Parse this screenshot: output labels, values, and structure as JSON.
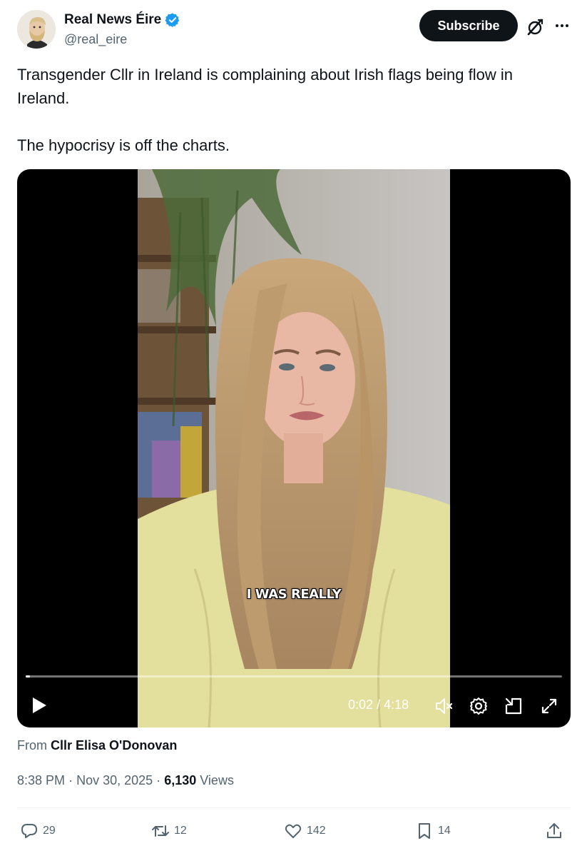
{
  "author": {
    "display_name": "Real News Éire",
    "handle": "@real_eire",
    "verified": true,
    "avatar_icon": "bearded-man-avatar"
  },
  "header": {
    "subscribe_label": "Subscribe",
    "grok_icon": "grok-icon",
    "more_icon": "more-icon"
  },
  "tweet": {
    "line1": "Transgender Cllr in Ireland is complaining about Irish flags being flow in Ireland.",
    "line2": "The hypocrisy is off the charts."
  },
  "video": {
    "caption": "I WAS REALLY",
    "current_time": "0:02",
    "separator": "/",
    "duration": "4:18",
    "progress_fraction": 0.008,
    "controls": [
      "play-icon",
      "mute-icon",
      "settings-icon",
      "pip-icon",
      "fullscreen-icon"
    ]
  },
  "source": {
    "prefix": "From",
    "name": "Cllr Elisa O'Donovan"
  },
  "meta": {
    "time": "8:38 PM",
    "date": "Nov 30, 2025",
    "views_count": "6,130",
    "views_label": "Views"
  },
  "actions": {
    "replies": "29",
    "reposts": "12",
    "likes": "142",
    "bookmarks": "14"
  },
  "colors": {
    "accent_verified": "#1d9bf0",
    "text_primary": "#0f1419",
    "text_secondary": "#536471",
    "button_dark": "#0f1419"
  }
}
